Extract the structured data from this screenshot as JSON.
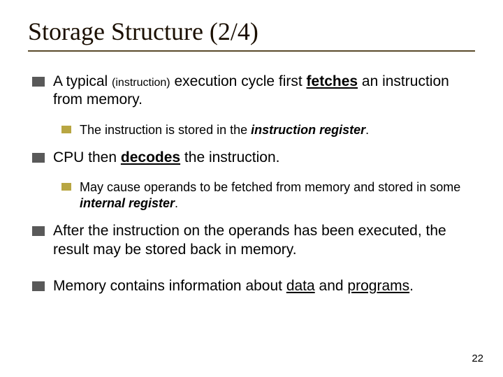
{
  "title": "Storage Structure (2/4)",
  "bullets": {
    "p1": {
      "a": "A typical ",
      "instr": "(instruction)",
      "b": " execution cycle first ",
      "fetches": "fetches",
      "c": " an instruction from memory."
    },
    "p1s": {
      "a": "The instruction is stored in the ",
      "ir": "instruction register",
      "b": "."
    },
    "p2": {
      "a": "CPU then ",
      "dec": "decodes",
      "b": " the instruction."
    },
    "p2s": {
      "a": "May cause operands to be fetched from memory and stored in some ",
      "ir": "internal register",
      "b": "."
    },
    "p3": "After the instruction on the operands has been executed, the result may be stored back in memory.",
    "p4": {
      "a": "Memory contains information about ",
      "data": "data",
      "and": " and ",
      "programs": "programs",
      "b": "."
    }
  },
  "page": "22"
}
